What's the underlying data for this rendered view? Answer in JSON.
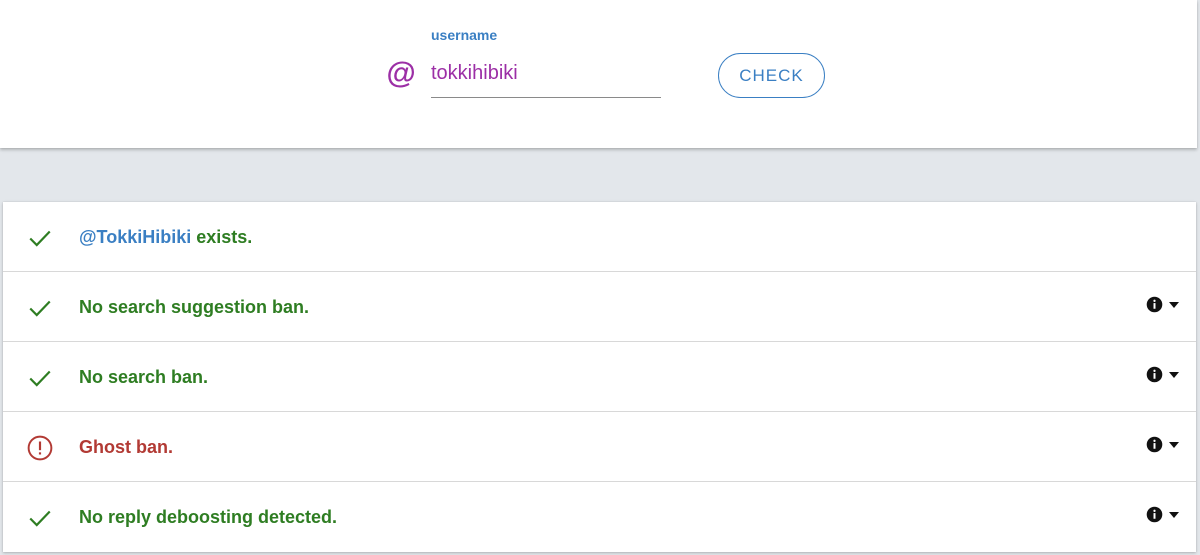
{
  "search": {
    "field_label": "username",
    "value": "tokkihibiki",
    "at_symbol": "@",
    "button_label": "CHECK"
  },
  "results": [
    {
      "status": "ok",
      "handle": "@TokkiHibiki",
      "text": " exists.",
      "has_details": false
    },
    {
      "status": "ok",
      "text": "No search suggestion ban.",
      "has_details": true
    },
    {
      "status": "ok",
      "text": "No search ban.",
      "has_details": true
    },
    {
      "status": "bad",
      "text": "Ghost ban.",
      "has_details": true
    },
    {
      "status": "ok",
      "text": "No reply deboosting detected.",
      "has_details": true
    }
  ],
  "icons": {
    "ok": "check-icon",
    "bad": "alert-circle-icon",
    "details": "info-icon",
    "expand": "caret-down-icon"
  },
  "colors": {
    "accent": "#3a7fc3",
    "username": "#9c2fa6",
    "ok": "#2e7d22",
    "bad": "#b23a34"
  }
}
